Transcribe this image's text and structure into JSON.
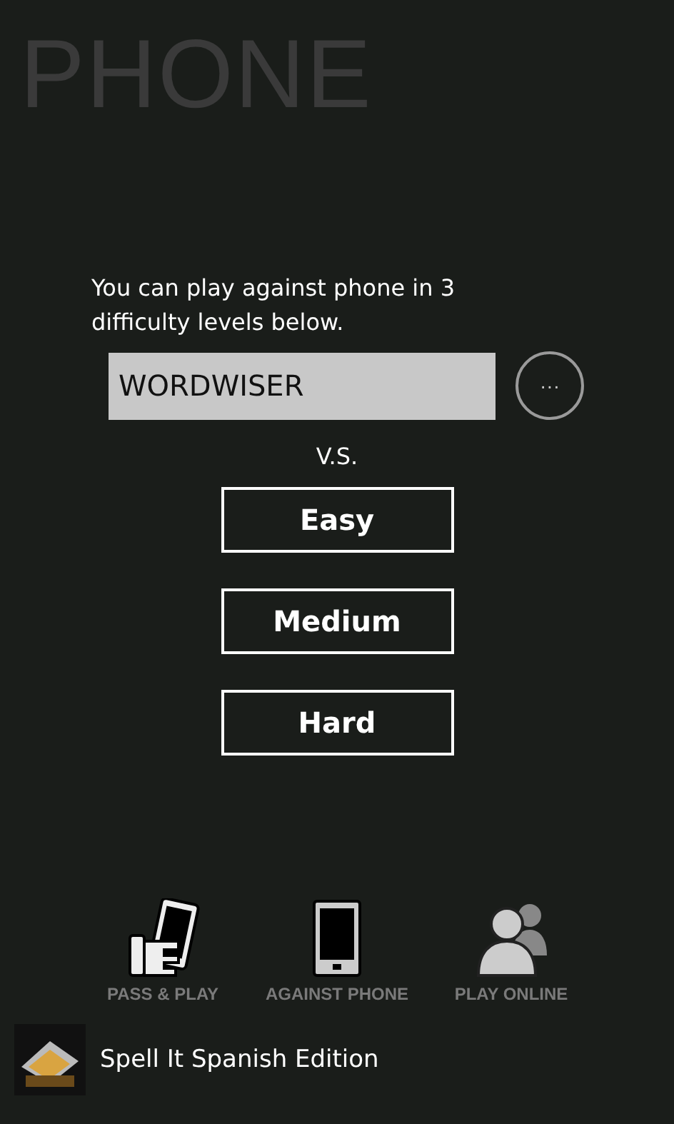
{
  "page_title": "PHONE",
  "description": "You can play against phone in 3 difficulty levels below.",
  "player_field": {
    "value": "WORDWISER"
  },
  "more_button": {
    "label": "···"
  },
  "versus": "V.S.",
  "difficulties": [
    {
      "label": "Easy"
    },
    {
      "label": "Medium"
    },
    {
      "label": "Hard"
    }
  ],
  "modes": [
    {
      "kind": "pass",
      "label": "PASS & PLAY"
    },
    {
      "kind": "phone",
      "label": "AGAINST PHONE"
    },
    {
      "kind": "online",
      "label": "PLAY ONLINE"
    }
  ],
  "app": {
    "name": "Spell It Spanish Edition"
  }
}
